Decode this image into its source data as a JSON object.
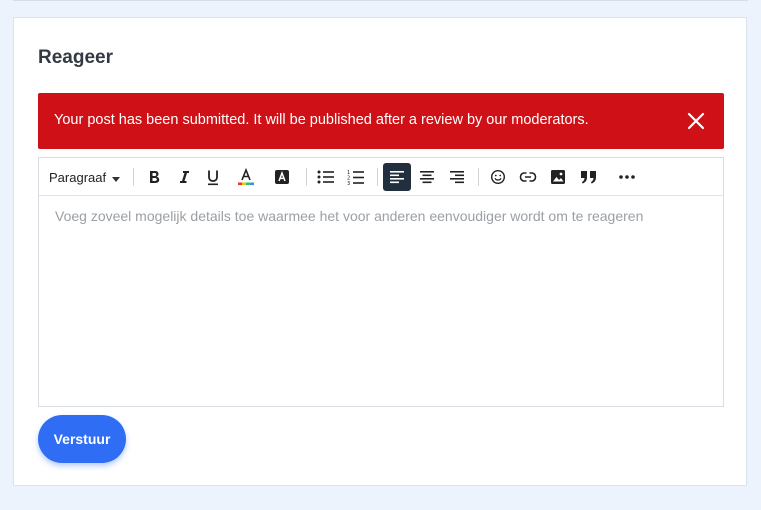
{
  "form": {
    "title": "Reageer",
    "submit_label": "Verstuur"
  },
  "alert": {
    "message": "Your post has been submitted. It will be published after a review by our moderators.",
    "close_icon": "close-icon",
    "background": "#cf1117"
  },
  "editor": {
    "block_format": "Paragraaf",
    "placeholder": "Voeg zoveel mogelijk details toe waarmee het voor anderen eenvoudiger wordt om te reageren",
    "toolbar_icons": [
      "bold-icon",
      "italic-icon",
      "underline-icon",
      "text-color-icon",
      "background-color-icon",
      "bullet-list-icon",
      "numbered-list-icon",
      "align-left-icon",
      "align-center-icon",
      "align-right-icon",
      "emoji-icon",
      "link-icon",
      "image-icon",
      "blockquote-icon",
      "more-icon"
    ],
    "active_alignment": "left"
  },
  "colors": {
    "accent": "#2f6df5",
    "toolbar_active": "#222f3e"
  }
}
